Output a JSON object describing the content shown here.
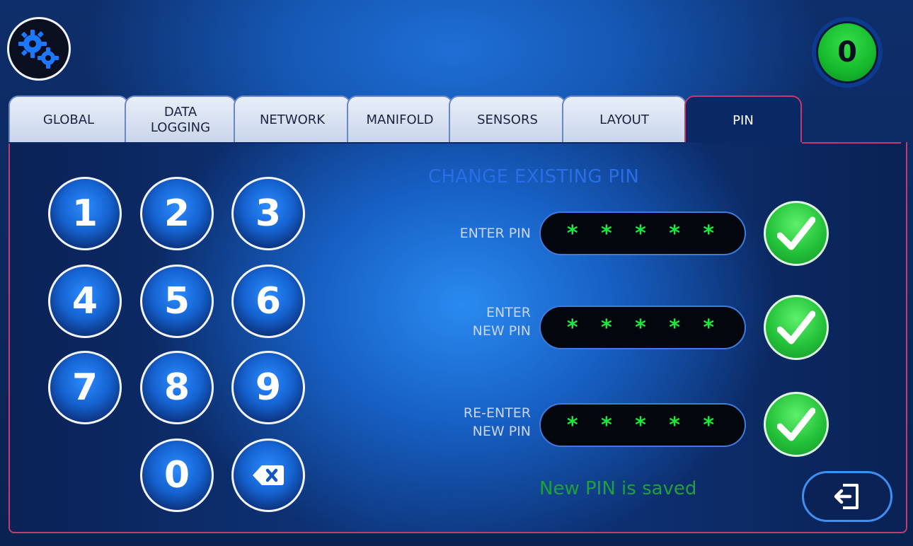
{
  "header": {
    "settings_icon": "gears-icon",
    "status_badge": "0",
    "status_color": "#16b92c"
  },
  "tabs": [
    {
      "label": "GLOBAL",
      "active": false
    },
    {
      "label": "DATA\nLOGGING",
      "active": false
    },
    {
      "label": "NETWORK",
      "active": false
    },
    {
      "label": "MANIFOLD",
      "active": false
    },
    {
      "label": "SENSORS",
      "active": false
    },
    {
      "label": "LAYOUT",
      "active": false
    },
    {
      "label": "PIN",
      "active": true
    }
  ],
  "keypad": {
    "keys": [
      "1",
      "2",
      "3",
      "4",
      "5",
      "6",
      "7",
      "8",
      "9",
      "0"
    ],
    "backspace_icon": "backspace-icon"
  },
  "pin_change": {
    "title": "CHANGE EXISTING PIN",
    "fields": [
      {
        "label": "ENTER PIN",
        "value": "*****"
      },
      {
        "label": "ENTER\nNEW PIN",
        "value": "*****"
      },
      {
        "label": "RE-ENTER\nNEW PIN",
        "value": "*****"
      }
    ],
    "confirm_icon": "checkmark-icon",
    "status_message": "New PIN is saved"
  },
  "exit": {
    "icon": "exit-icon"
  },
  "colors": {
    "accent": "#2a6ee6",
    "pin_text": "#19e93a",
    "success": "#1fa03a",
    "tab_border_active": "#c43a73"
  }
}
